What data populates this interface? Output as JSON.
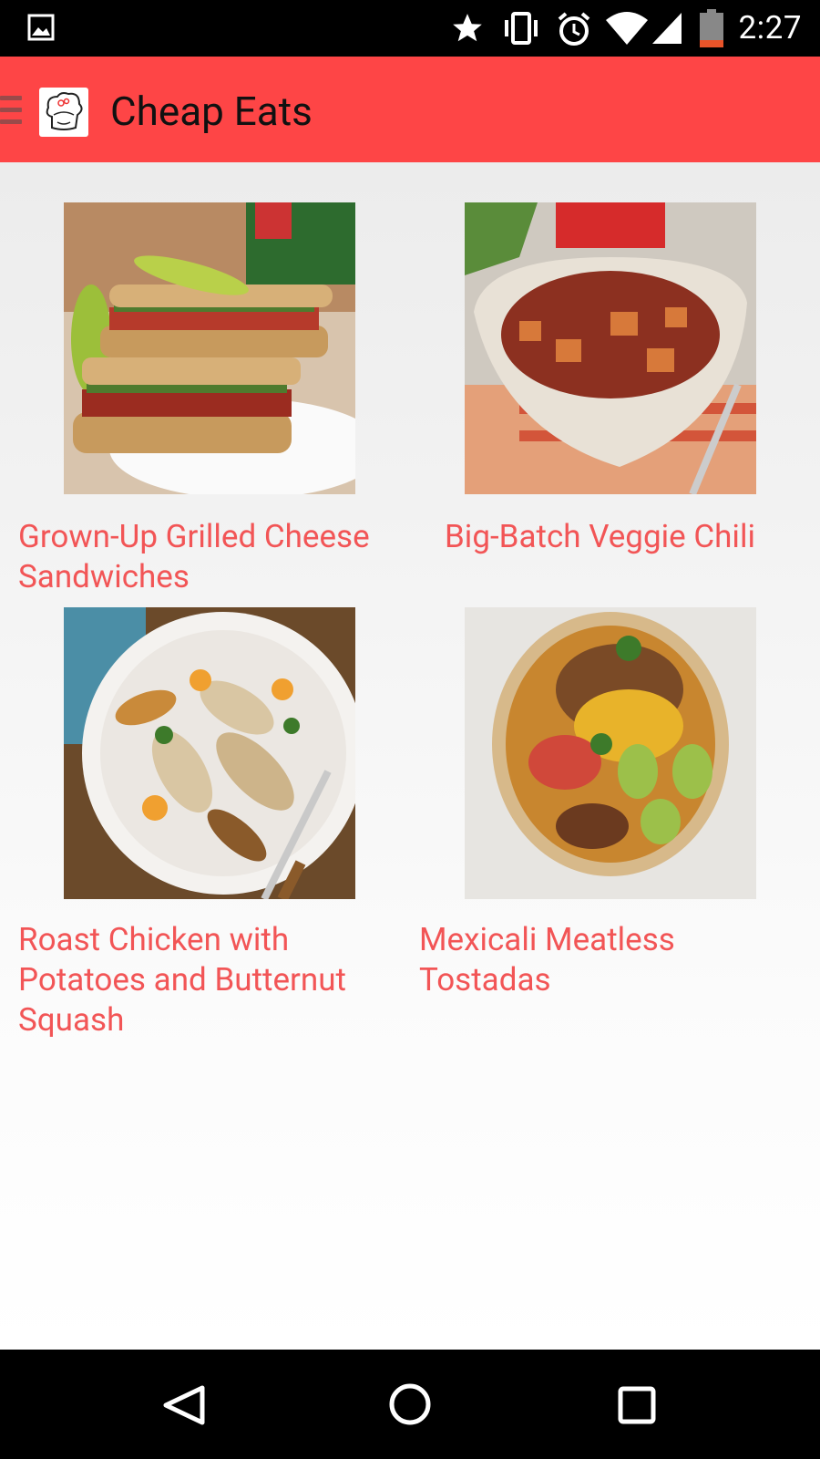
{
  "status_bar": {
    "time": "2:27",
    "icons": [
      "image-icon",
      "star-icon",
      "vibrate-icon",
      "alarm-icon",
      "wifi-icon",
      "signal-icon",
      "battery-icon"
    ]
  },
  "app_bar": {
    "title": "Cheap Eats",
    "color": "#fe4546"
  },
  "recipes": [
    {
      "title": "Grown-Up Grilled Cheese\nSandwiches"
    },
    {
      "title": "Big-Batch Veggie Chili"
    },
    {
      "title": "Roast Chicken with\nPotatoes and Butternut\nSquash"
    },
    {
      "title": "Mexicali Meatless\nTostadas"
    }
  ],
  "nav_bar": {
    "buttons": [
      "back-icon",
      "home-icon",
      "recents-icon"
    ]
  }
}
